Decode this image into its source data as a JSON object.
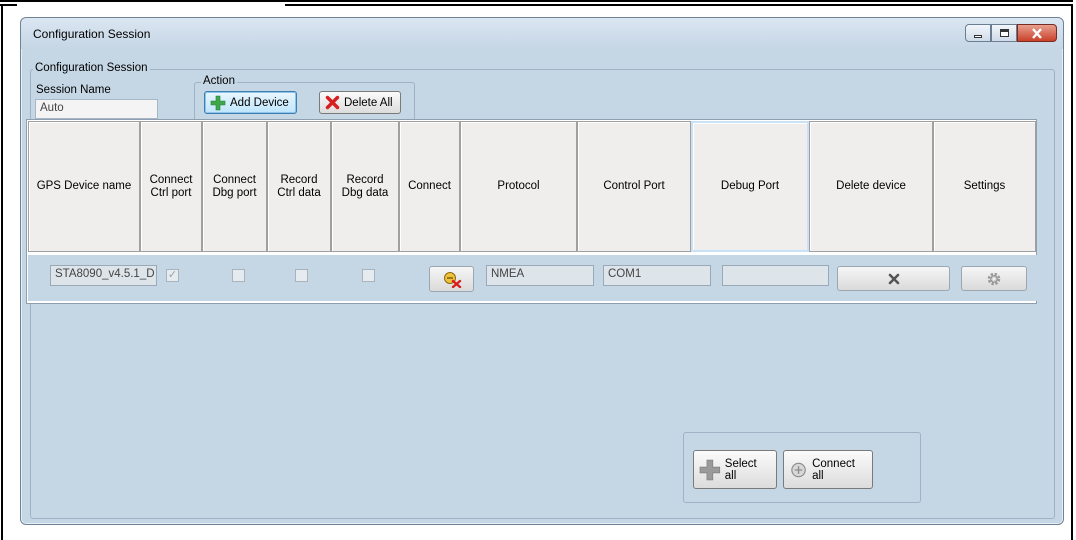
{
  "window": {
    "title": "Configuration Session"
  },
  "group": {
    "legend": "Configuration Session"
  },
  "session": {
    "label": "Session Name",
    "value": "Auto"
  },
  "action": {
    "legend": "Action",
    "add_device": "Add Device",
    "delete_all": "Delete All"
  },
  "table": {
    "headers": {
      "name": "GPS Device name",
      "connect_ctrl": "Connect\nCtrl port",
      "connect_dbg": "Connect\nDbg port",
      "record_ctrl": "Record\nCtrl data",
      "record_dbg": "Record\nDbg data",
      "connect": "Connect",
      "protocol": "Protocol",
      "control_port": "Control Port",
      "debug_port": "Debug Port",
      "delete_device": "Delete device",
      "settings": "Settings"
    },
    "row": {
      "name": "STA8090_v4.5.1_D",
      "connect_ctrl": true,
      "connect_dbg": false,
      "record_ctrl": false,
      "record_dbg": false,
      "protocol": "NMEA",
      "control_port": "COM1",
      "debug_port": ""
    }
  },
  "footer": {
    "select_all": "Select all",
    "connect_all": "Connect all"
  },
  "icons": {
    "add": "plus-icon",
    "delete": "red-x-icon",
    "connect": "disconnected-plug-icon",
    "remove": "x-icon",
    "settings": "gear-icon"
  }
}
